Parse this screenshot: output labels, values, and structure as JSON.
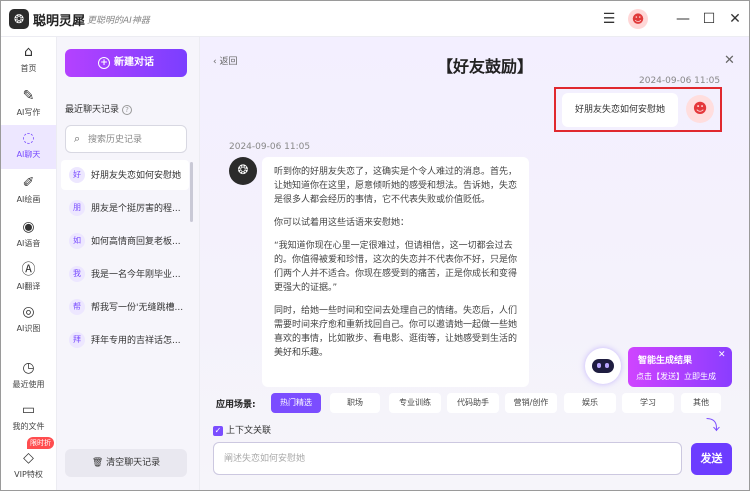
{
  "app": {
    "name": "聪明灵犀",
    "slogan": "更聪明的AI神器",
    "logo_glyph": "❂"
  },
  "titlebar": {
    "menu_icon": "☰",
    "minimize_icon": "—",
    "maximize_icon": "☐",
    "close_icon": "✕",
    "avatar_glyph": "☻"
  },
  "sidebar": {
    "items": [
      {
        "label": "首页",
        "icon": "⌂"
      },
      {
        "label": "AI写作",
        "icon": "✎"
      },
      {
        "label": "AI聊天",
        "icon": "◌"
      },
      {
        "label": "AI绘画",
        "icon": "✐"
      },
      {
        "label": "AI语音",
        "icon": "◉"
      },
      {
        "label": "AI翻译",
        "icon": "Ⓐ"
      },
      {
        "label": "AI识图",
        "icon": "◎"
      },
      {
        "label": "最近使用",
        "icon": "◷"
      },
      {
        "label": "我的文件",
        "icon": "▭"
      },
      {
        "label": "VIP特权",
        "icon": "◇"
      }
    ],
    "active_index": 2,
    "vip_badge": "限时折"
  },
  "chatlist": {
    "new_chat": "新建对话",
    "recent_title": "最近聊天记录",
    "search_placeholder": "搜索历史记录",
    "history": [
      {
        "avatar": "好",
        "text": "好朋友失恋如何安慰她"
      },
      {
        "avatar": "朋",
        "text": "朋友是个挺厉害的程..."
      },
      {
        "avatar": "如",
        "text": "如何高情商回复老板..."
      },
      {
        "avatar": "我",
        "text": "我是一名今年刚毕业..."
      },
      {
        "avatar": "帮",
        "text": "帮我写一份'无缝跳槽..."
      },
      {
        "avatar": "拜",
        "text": "拜年专用的吉祥话怎..."
      }
    ],
    "active_index": 0,
    "clear": "清空聊天记录"
  },
  "chat": {
    "back": "返回",
    "title": "【好友鼓励】",
    "user_time": "2024-09-06 11:05",
    "user_msg": "好朋友失恋如何安慰她",
    "ai_time": "2024-09-06 11:05",
    "ai_paragraphs": [
      "听到你的好朋友失恋了，这确实是个令人难过的消息。首先，让她知道你在这里，愿意倾听她的感受和想法。告诉她，失恋是很多人都会经历的事情，它不代表失败或价值贬低。",
      "你可以试着用这些话语来安慰她：",
      "“我知道你现在心里一定很难过，但请相信，这一切都会过去的。你值得被爱和珍惜，这次的失恋并不代表你不好，只是你们两个人并不适合。你现在感受到的痛苦，正是你成长和变得更强大的证据。”",
      "同时，给她一些时间和空间去处理自己的情绪。失恋后，人们需要时间来疗愈和重新找回自己。你可以邀请她一起做一些她喜欢的事情，比如散步、看电影、逛街等，让她感受到生活的美好和乐趣。"
    ]
  },
  "scenes": {
    "label": "应用场景:",
    "items": [
      "热门精选",
      "职场",
      "专业训练",
      "代码助手",
      "营销/创作",
      "娱乐",
      "学习",
      "其他"
    ],
    "active_index": 0
  },
  "context": {
    "label": "上下文关联",
    "checked": true
  },
  "composer": {
    "placeholder": "阐述失恋如何安慰她",
    "send": "发送"
  },
  "promo": {
    "title": "智能生成结果",
    "subtitle": "点击【发送】立即生成"
  },
  "colors": {
    "accent": "#7b4dff",
    "highlight_box": "#e0282e"
  }
}
